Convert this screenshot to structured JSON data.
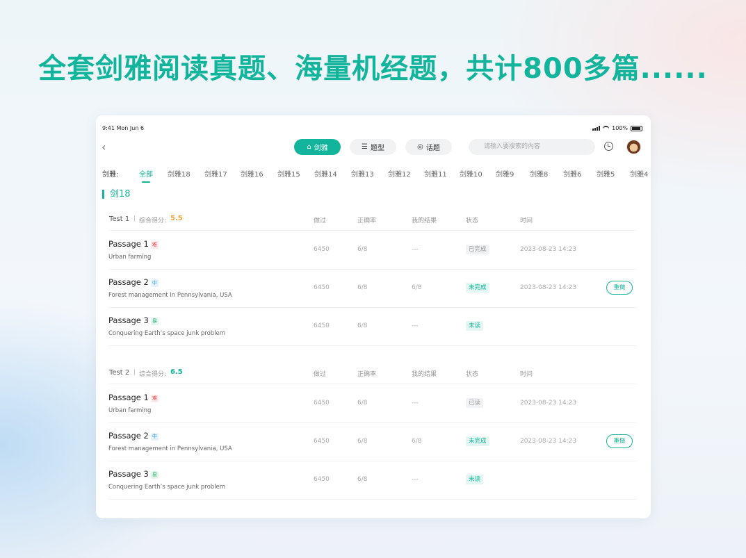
{
  "headline": "全套剑雅阅读真题、海量机经题，共计800多篇......",
  "status_bar": {
    "time": "9:41  Mon Jun 6",
    "battery": "100%"
  },
  "tabs": [
    {
      "label": "剑雅",
      "icon": "building-icon"
    },
    {
      "label": "题型",
      "icon": "list-icon"
    },
    {
      "label": "话题",
      "icon": "chat-icon"
    }
  ],
  "search": {
    "placeholder": "请输入要搜索的内容"
  },
  "categories": {
    "label": "剑雅:",
    "items": [
      "全部",
      "剑雅18",
      "剑雅17",
      "剑雅16",
      "剑雅15",
      "剑雅14",
      "剑雅13",
      "剑雅12",
      "剑雅11",
      "剑雅10",
      "剑雅9",
      "剑雅8",
      "剑雅6",
      "剑雅5",
      "剑雅4"
    ]
  },
  "section_title": "剑18",
  "columns": {
    "done": "做过",
    "accuracy": "正确率",
    "result": "我的结果",
    "status": "状态",
    "time": "时间"
  },
  "redo_label": "重做",
  "colors": {
    "accent": "#12b49b",
    "score_orange": "#f0a23a",
    "hard": "#ef4c4c",
    "medium": "#3a9de8",
    "easy": "#27b36f"
  },
  "tests": [
    {
      "name": "Test 1",
      "score_label": "综合得分:",
      "score": "5.5",
      "passages": [
        {
          "title": "Passage 1",
          "difficulty": "难",
          "subtitle": "Urban farming",
          "done": "6450",
          "accuracy": "6/8",
          "result": "---",
          "status": "已完成",
          "time": "2023-08-23 14:23"
        },
        {
          "title": "Passage 2",
          "difficulty": "中",
          "subtitle": "Forest management in Pennsylvania, USA",
          "done": "6450",
          "accuracy": "6/8",
          "result": "6/8",
          "status": "未完成",
          "time": "2023-08-23 14:23"
        },
        {
          "title": "Passage 3",
          "difficulty": "易",
          "subtitle": "Conquering Earth’s space junk problem",
          "done": "6450",
          "accuracy": "6/8",
          "result": "---",
          "status": "未读",
          "time": ""
        }
      ]
    },
    {
      "name": "Test 2",
      "score_label": "综合得分:",
      "score": "6.5",
      "passages": [
        {
          "title": "Passage 1",
          "difficulty": "难",
          "subtitle": "Urban farming",
          "done": "6450",
          "accuracy": "6/8",
          "result": "---",
          "status": "已读",
          "time": "2023-08-23 14:23"
        },
        {
          "title": "Passage 2",
          "difficulty": "中",
          "subtitle": "Forest management in Pennsylvania, USA",
          "done": "6450",
          "accuracy": "6/8",
          "result": "6/8",
          "status": "未完成",
          "time": "2023-08-23 14:23"
        },
        {
          "title": "Passage 3",
          "difficulty": "易",
          "subtitle": "Conquering Earth’s space junk problem",
          "done": "6450",
          "accuracy": "6/8",
          "result": "---",
          "status": "未读",
          "time": ""
        }
      ]
    }
  ]
}
